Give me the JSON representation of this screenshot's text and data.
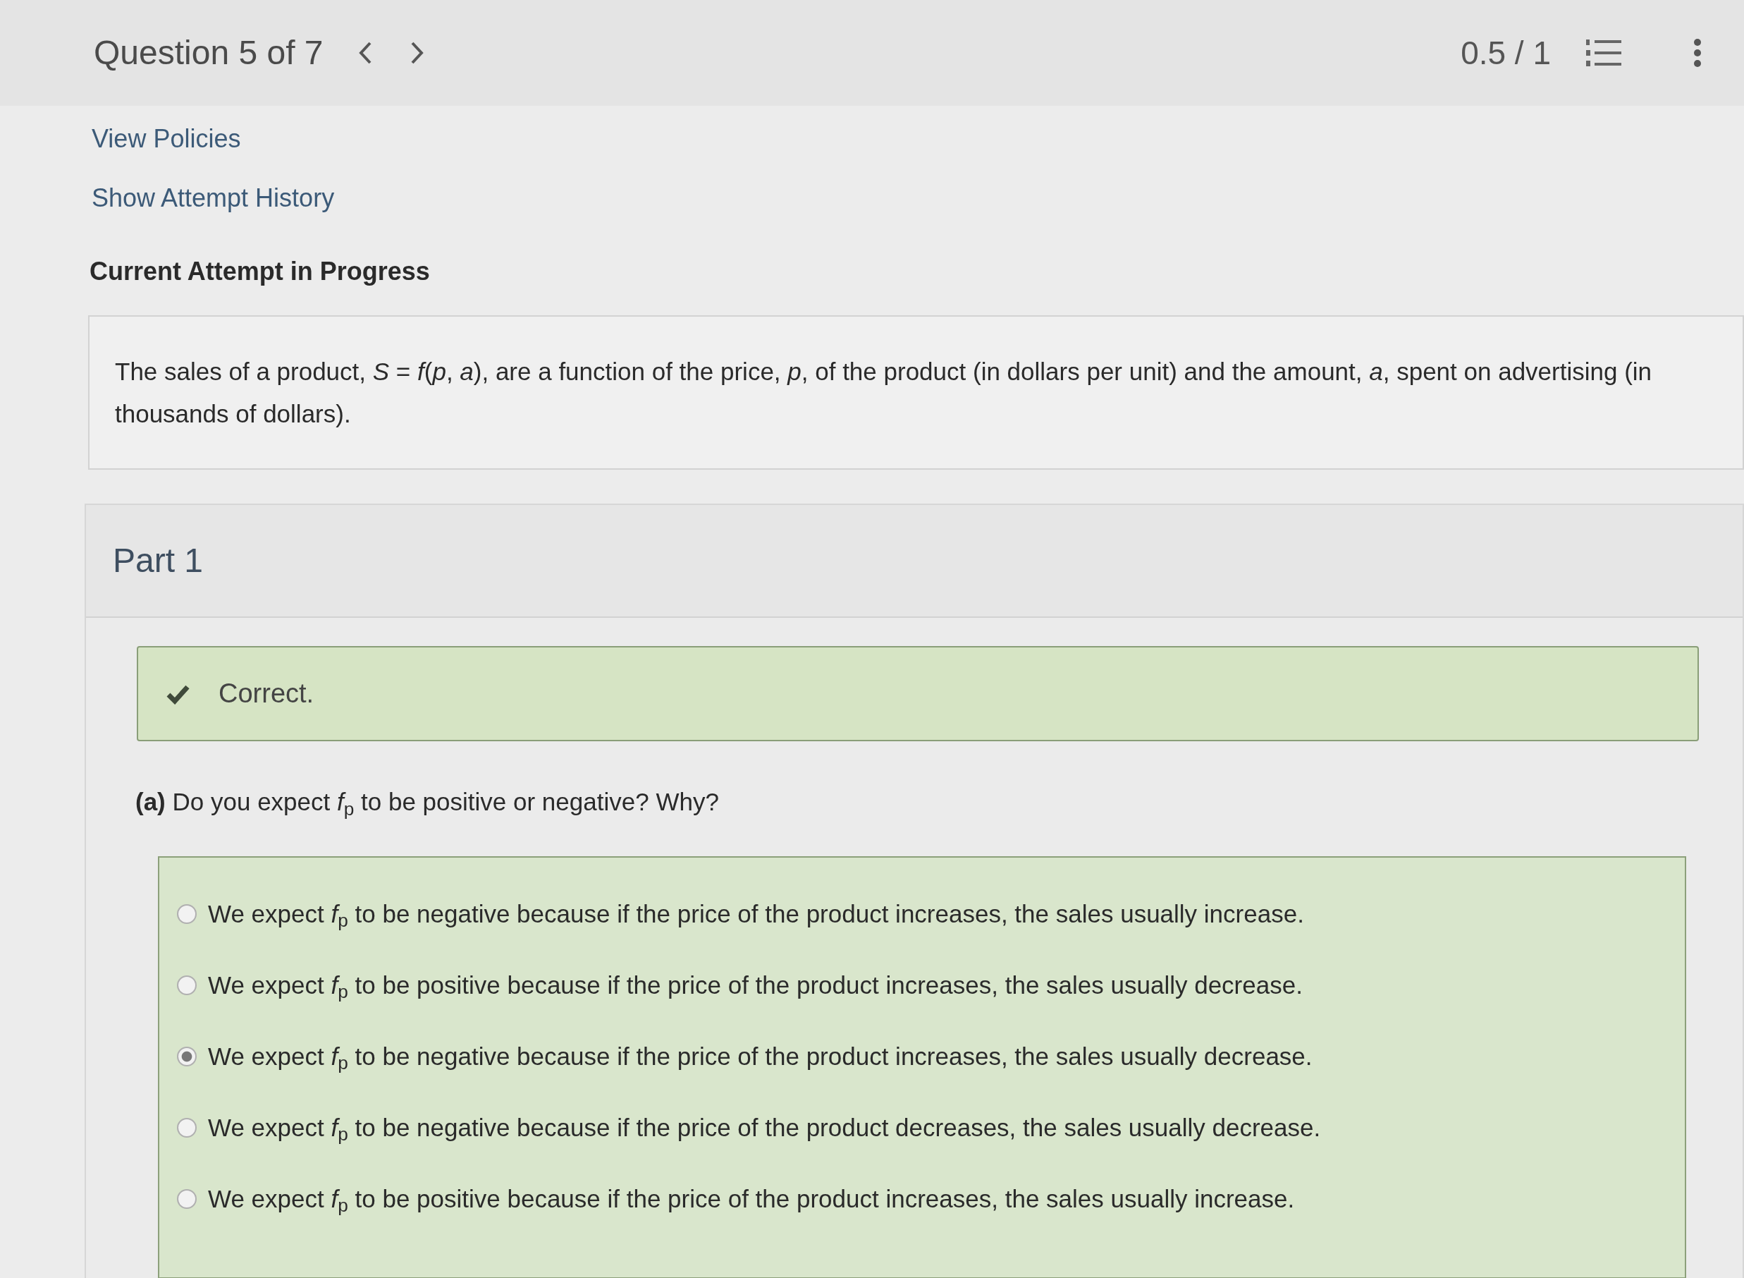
{
  "header": {
    "title": "Question 5 of 7",
    "score": "0.5 / 1"
  },
  "links": [
    "View Policies",
    "Show Attempt History"
  ],
  "attempt_heading": "Current Attempt in Progress",
  "question": "The sales of a product, *S* = *f*(*p*, *a*), are a function of the price, *p*, of the product (in dollars per unit) and the amount, *a*, spent on advertising (in thousands of dollars).",
  "part": {
    "title": "Part 1",
    "feedback": {
      "kind": "correct",
      "text": "Correct."
    },
    "prompt": "**(a)** Do you expect *f*$_{p}$ to be positive or negative? Why?",
    "options": [
      {
        "text": "We expect *f*$_{p}$ to be negative because if the price of the product increases, the sales usually increase.",
        "selected": false
      },
      {
        "text": "We expect *f*$_{p}$ to be positive because if the price of the product increases, the sales usually decrease.",
        "selected": false
      },
      {
        "text": "We expect *f*$_{p}$ to be negative because if the price of the product increases, the sales usually decrease.",
        "selected": true
      },
      {
        "text": "We expect *f*$_{p}$ to be negative because if the price of the product decreases, the sales usually decrease.",
        "selected": false
      },
      {
        "text": "We expect *f*$_{p}$ to be positive because if the price of the product increases, the sales usually increase.",
        "selected": false
      }
    ]
  }
}
